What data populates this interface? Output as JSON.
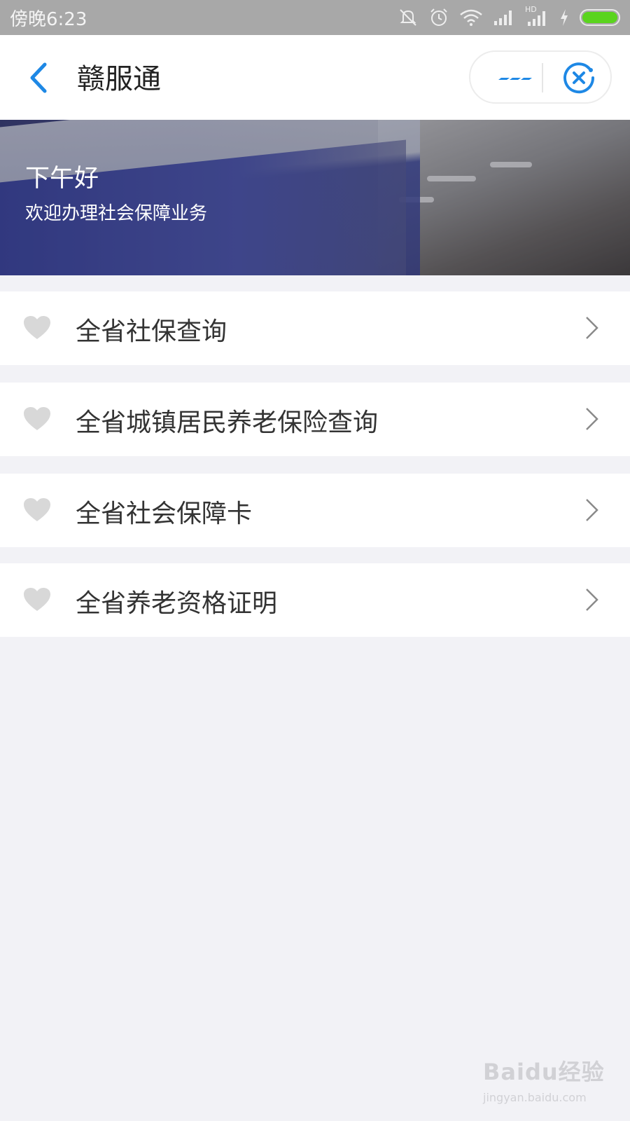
{
  "status_bar": {
    "time": "傍晚6:23",
    "icons": [
      "mute-icon",
      "alarm-icon",
      "wifi-icon",
      "signal-icon",
      "hd-signal-icon",
      "charging-icon",
      "battery-icon"
    ],
    "hd_label": "HD",
    "battery_color": "#5ad41e"
  },
  "nav": {
    "title": "赣服通",
    "accent_color": "#1e88e5"
  },
  "banner": {
    "greeting": "下午好",
    "subtitle": "欢迎办理社会保障业务"
  },
  "list": {
    "items": [
      {
        "label": "全省社保查询",
        "icon": "heart-icon"
      },
      {
        "label": "全省城镇居民养老保险查询",
        "icon": "heart-icon"
      },
      {
        "label": "全省社会保障卡",
        "icon": "heart-icon"
      },
      {
        "label": "全省养老资格证明",
        "icon": "heart-icon"
      }
    ]
  },
  "watermark": {
    "brand": "Baidu经验",
    "url": "jingyan.baidu.com"
  }
}
